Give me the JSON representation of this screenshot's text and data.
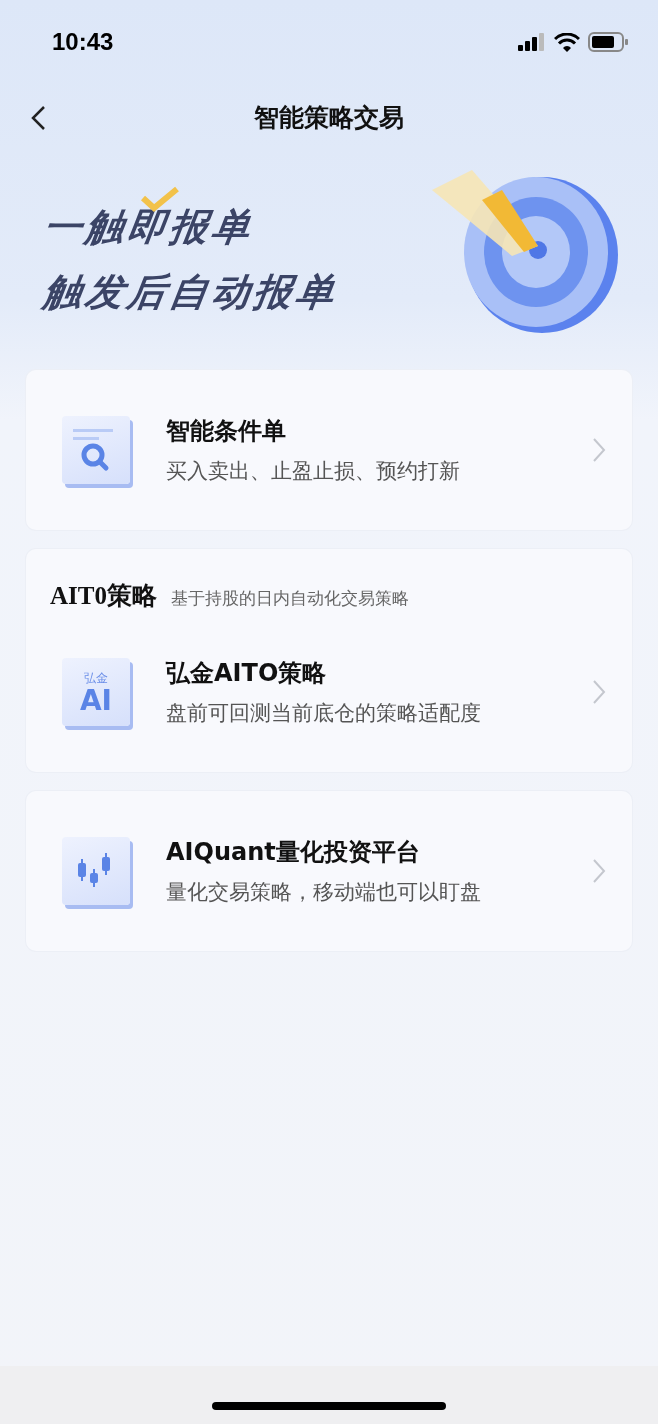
{
  "status_bar": {
    "time": "10:43"
  },
  "header": {
    "title": "智能策略交易"
  },
  "banner": {
    "lines": [
      "一触即报单",
      "触发后自动报单"
    ]
  },
  "sections": [
    {
      "kind": "single",
      "items": [
        {
          "kind": "search",
          "title": "智能条件单",
          "subtitle": "买入卖出、止盈止损、预约打新"
        }
      ]
    },
    {
      "kind": "group",
      "header": {
        "title": "AIT0策略",
        "note": "基于持股的日内自动化交易策略"
      },
      "items": [
        {
          "kind": "ai",
          "icon_texts": [
            "弘金",
            "AI"
          ],
          "title": "弘金AITO策略",
          "subtitle": "盘前可回测当前底仓的策略适配度"
        }
      ]
    },
    {
      "kind": "single",
      "items": [
        {
          "kind": "candles",
          "title": "AIQuant量化投资平台",
          "subtitle": "量化交易策略，移动端也可以盯盘"
        }
      ]
    }
  ]
}
